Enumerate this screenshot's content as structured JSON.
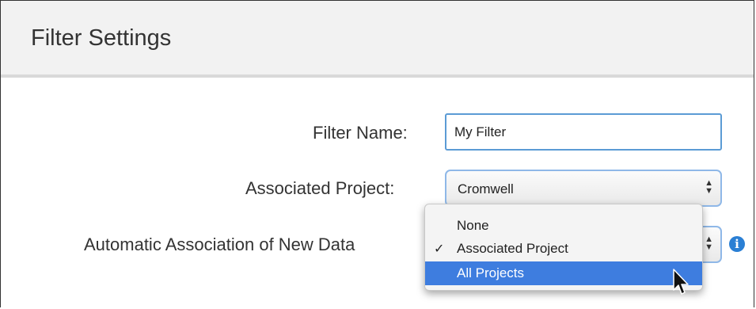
{
  "dialog": {
    "title": "Filter Settings"
  },
  "form": {
    "filter_name": {
      "label": "Filter Name:",
      "value": "My Filter"
    },
    "associated_project": {
      "label": "Associated Project:",
      "selected": "Cromwell"
    },
    "automatic_association": {
      "label": "Automatic Association of New Data"
    }
  },
  "dropdown": {
    "options": [
      {
        "label": "None",
        "checked": false,
        "highlighted": false
      },
      {
        "label": "Associated Project",
        "checked": true,
        "highlighted": false
      },
      {
        "label": "All Projects",
        "checked": false,
        "highlighted": true
      }
    ],
    "check_mark": "✓"
  },
  "icons": {
    "info": "info-icon",
    "select_arrows": "up-down-arrows-icon",
    "cursor": "mouse-pointer-icon"
  },
  "colors": {
    "highlight": "#3e7ddf",
    "focus_border": "#5b9bd5",
    "info": "#2a7fd4"
  }
}
